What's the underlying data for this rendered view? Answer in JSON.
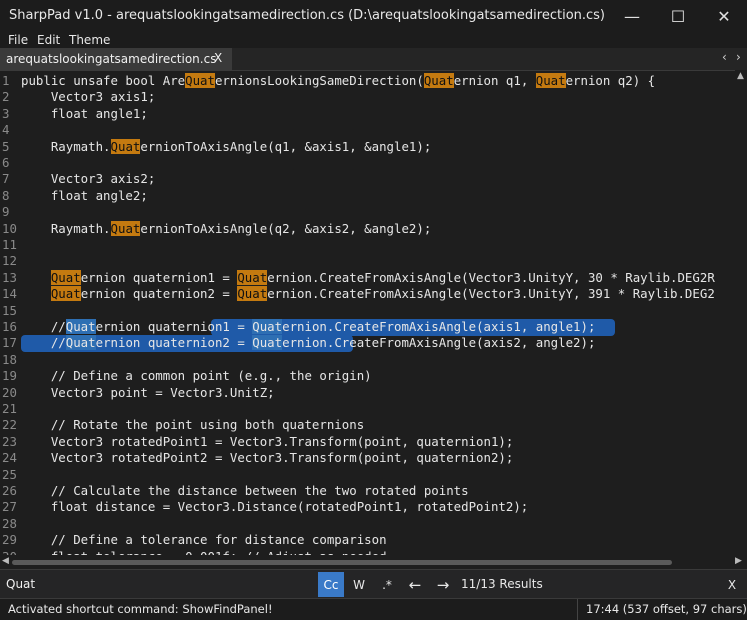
{
  "window": {
    "title": "SharpPad v1.0 - arequatslookingatsamedirection.cs (D:\\arequatslookingatsamedirection.cs)",
    "minimize_glyph": "—",
    "maximize_glyph": "☐",
    "close_glyph": "✕"
  },
  "menu": [
    "File",
    "Edit",
    "Theme"
  ],
  "tab": {
    "label": "arequatslookingatsamedirection.cs",
    "close": "X"
  },
  "editor": {
    "search_term": "Quat",
    "lines": [
      "public unsafe bool AreQuaternionsLookingSameDirection(Quaternion q1, Quaternion q2) {",
      "    Vector3 axis1;",
      "    float angle1;",
      "",
      "    Raymath.QuaternionToAxisAngle(q1, &axis1, &angle1);",
      "",
      "    Vector3 axis2;",
      "    float angle2;",
      "",
      "    Raymath.QuaternionToAxisAngle(q2, &axis2, &angle2);",
      "",
      "",
      "    Quaternion quaternion1 = Quaternion.CreateFromAxisAngle(Vector3.UnityY, 30 * Raylib.DEG2R",
      "    Quaternion quaternion2 = Quaternion.CreateFromAxisAngle(Vector3.UnityY, 391 * Raylib.DEG2",
      "",
      "    //Quaternion quaternion1 = Quaternion.CreateFromAxisAngle(axis1, angle1);",
      "    //Quaternion quaternion2 = Quaternion.CreateFromAxisAngle(axis2, angle2);",
      "",
      "    // Define a common point (e.g., the origin)",
      "    Vector3 point = Vector3.UnitZ;",
      "",
      "    // Rotate the point using both quaternions",
      "    Vector3 rotatedPoint1 = Vector3.Transform(point, quaternion1);",
      "    Vector3 rotatedPoint2 = Vector3.Transform(point, quaternion2);",
      "",
      "    // Calculate the distance between the two rotated points",
      "    float distance = Vector3.Distance(rotatedPoint1, rotatedPoint2);",
      "",
      "    // Define a tolerance for distance comparison",
      "    float tolerance = 0.001f; // Adjust as needed"
    ]
  },
  "find": {
    "query": "Quat",
    "case_button": "Cc",
    "word_button": "W",
    "regex_button": ".*",
    "prev": "←",
    "next": "→",
    "results": "11/13 Results",
    "close": "X"
  },
  "status": {
    "message": "Activated shortcut command: ShowFindPanel!",
    "position": "17:44 (537 offset, 97 chars)"
  },
  "colors": {
    "match": "#c47a10",
    "selection": "#1f5aa8",
    "active_button": "#3a7ac8"
  }
}
